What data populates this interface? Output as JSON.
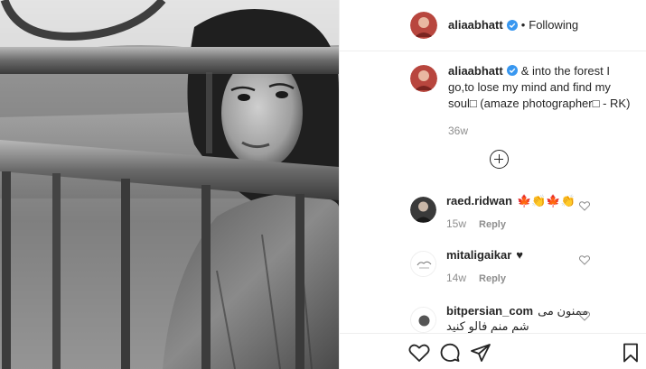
{
  "post": {
    "author": {
      "username": "aliaabhatt",
      "verified": true,
      "follow_state": "Following",
      "separator": "•"
    },
    "caption": {
      "username": "aliaabhatt",
      "text": "& into the forest I go,to lose my mind and find my soul□ (amaze photographer□ - RK)",
      "time": "36w"
    },
    "load_more_label": "+"
  },
  "comments": [
    {
      "username": "raed.ridwan",
      "text": "🍁👏🍁👏",
      "time": "15w",
      "reply_label": "Reply"
    },
    {
      "username": "mitaligaikar",
      "text": "♥",
      "time": "14w",
      "reply_label": "Reply"
    },
    {
      "username": "bitpersian_com",
      "text": "ممنون می شم منم فالو کنید",
      "time": "",
      "reply_label": ""
    }
  ],
  "actions": {
    "like": "heart-icon",
    "comment": "comment-bubble-icon",
    "share": "paper-plane-icon",
    "save": "bookmark-icon"
  },
  "colors": {
    "text": "#262626",
    "secondary": "#8e8e8e",
    "verified": "#3897f0",
    "divider": "#efefef"
  }
}
